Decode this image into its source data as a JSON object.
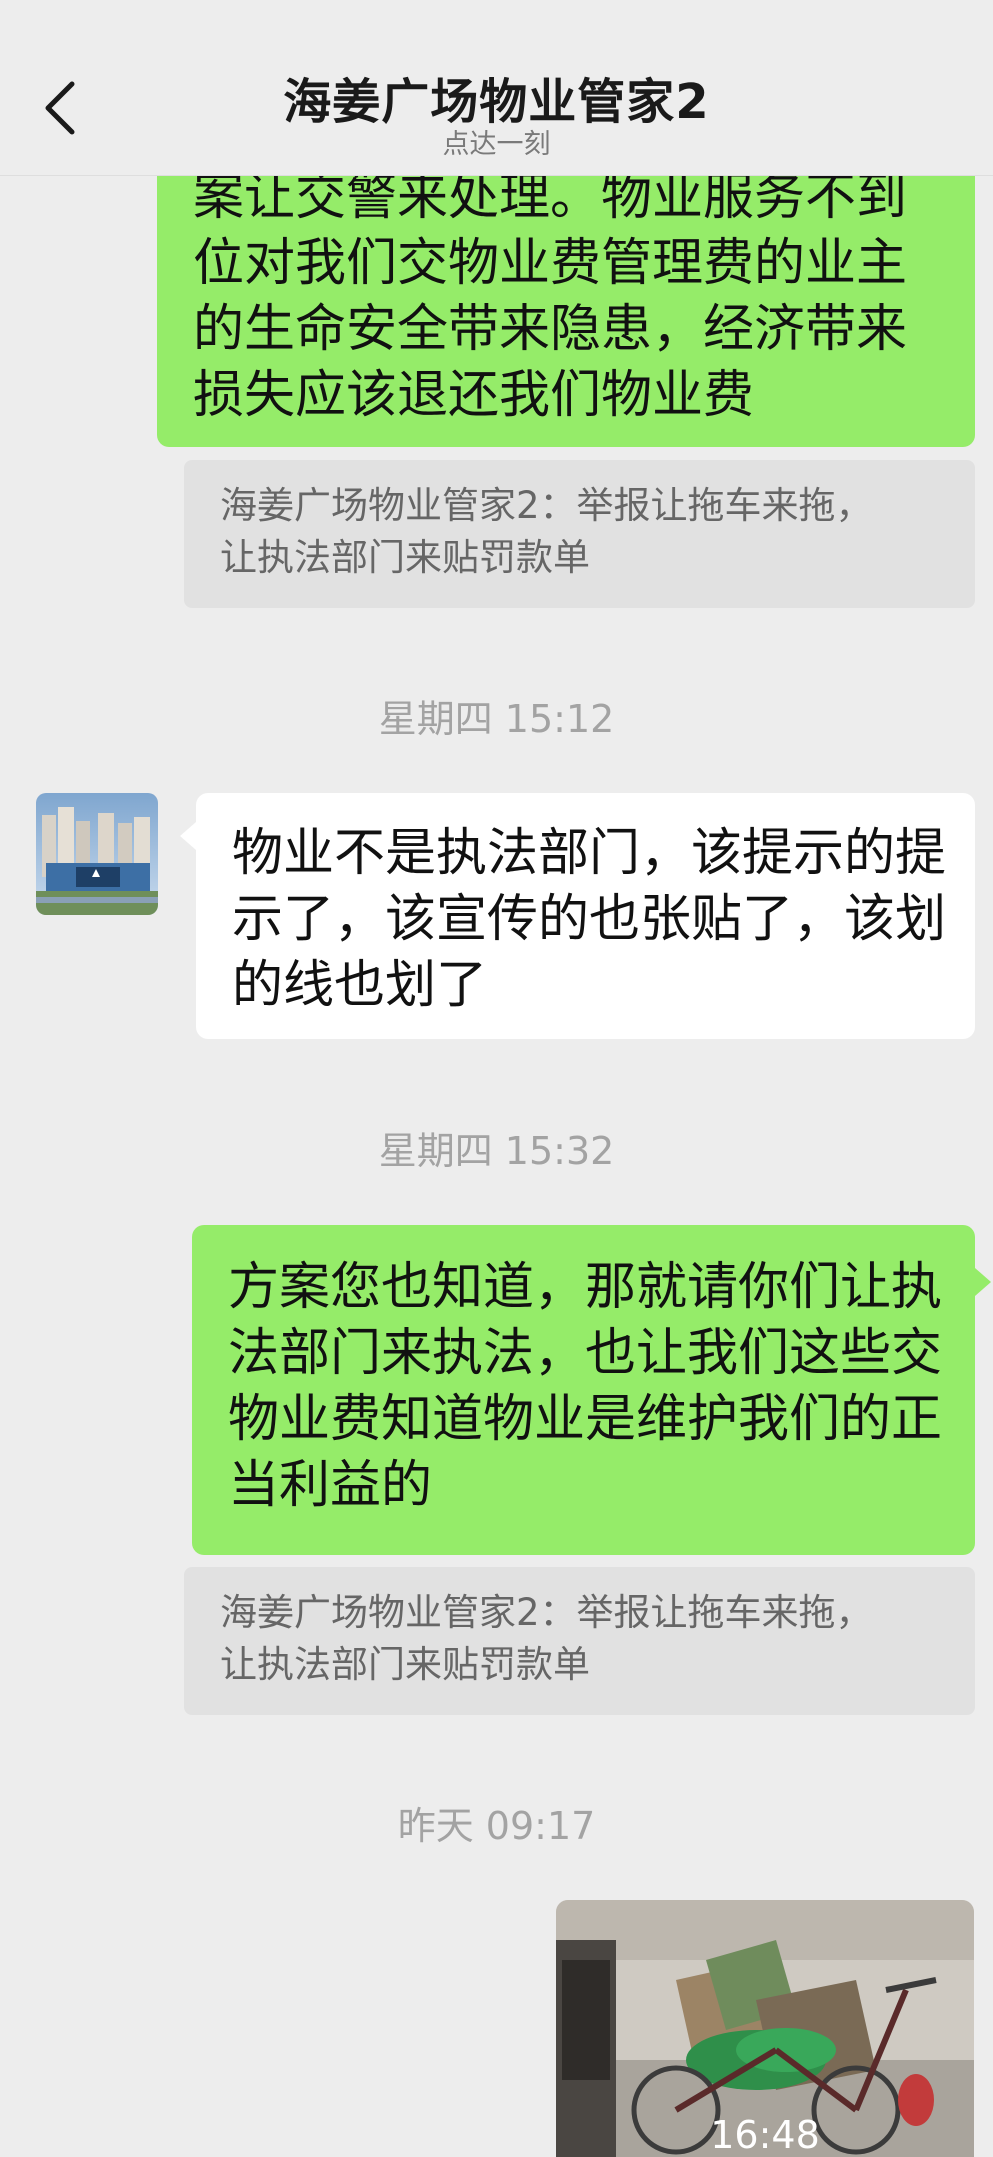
{
  "header": {
    "title": "海姜广场物业管家2",
    "subtitle": "点达一刻",
    "back_icon": "chevron-left-icon"
  },
  "messages": [
    {
      "side": "right",
      "type": "text",
      "lines": [
        "案让交警来处理。物业服务不到",
        "位对我们交物业费管理费的业主",
        "的生命安全带来隐患，经济带来",
        "损失应该退还我们物业费"
      ]
    },
    {
      "type": "quote",
      "lines": [
        "海姜广场物业管家2：举报让拖车来拖，",
        "让执法部门来贴罚款单"
      ]
    },
    {
      "type": "time",
      "text": "星期四 15:12"
    },
    {
      "side": "left",
      "type": "text",
      "lines": [
        "物业不是执法部门，该提示的提",
        "示了，该宣传的也张贴了，该划",
        "的线也划了"
      ]
    },
    {
      "type": "time",
      "text": "星期四 15:32"
    },
    {
      "side": "right",
      "type": "text",
      "lines": [
        "方案您也知道，那就请你们让执",
        "法部门来执法，也让我们这些交",
        "物业费知道物业是维护我们的正",
        "当利益的"
      ]
    },
    {
      "type": "quote",
      "lines": [
        "海姜广场物业管家2：举报让拖车来拖，",
        "让执法部门来贴罚款单"
      ]
    },
    {
      "type": "time",
      "text": "昨天 09:17"
    },
    {
      "side": "right",
      "type": "video",
      "duration": "16:48"
    }
  ],
  "colors": {
    "background": "#ededed",
    "outgoing_bubble": "#95ec69",
    "incoming_bubble": "#ffffff",
    "quote_background": "#e1e1e1"
  }
}
